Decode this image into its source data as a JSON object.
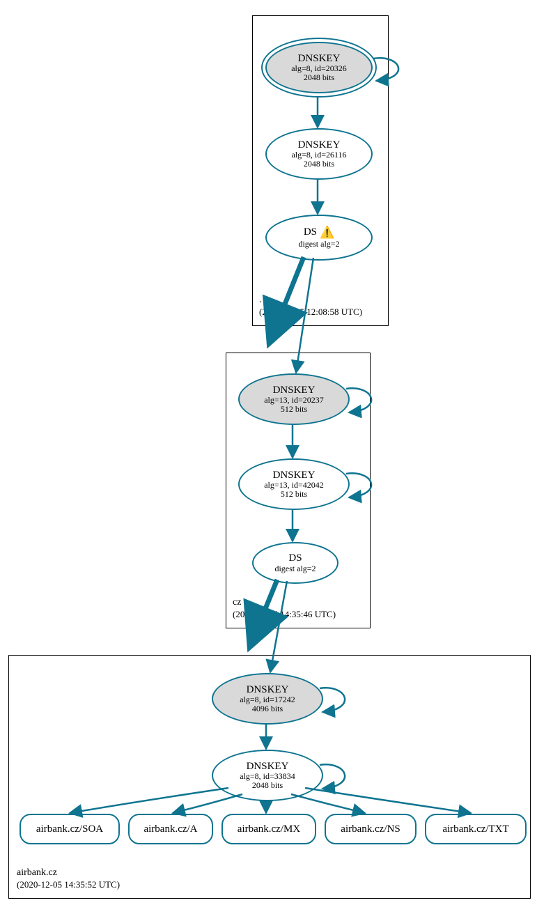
{
  "colors": {
    "stroke": "#0e7490",
    "ksk_fill": "#d9d9d9"
  },
  "zones": {
    "root": {
      "label": ".",
      "timestamp": "(2020-12-05 12:08:58 UTC)",
      "nodes": {
        "ksk": {
          "title": "DNSKEY",
          "line2": "alg=8, id=20326",
          "line3": "2048 bits"
        },
        "zsk": {
          "title": "DNSKEY",
          "line2": "alg=8, id=26116",
          "line3": "2048 bits"
        },
        "ds": {
          "title": "DS",
          "warn": "⚠️",
          "line2": "digest alg=2"
        }
      }
    },
    "cz": {
      "label": "cz",
      "timestamp": "(2020-12-05 14:35:46 UTC)",
      "nodes": {
        "ksk": {
          "title": "DNSKEY",
          "line2": "alg=13, id=20237",
          "line3": "512 bits"
        },
        "zsk": {
          "title": "DNSKEY",
          "line2": "alg=13, id=42042",
          "line3": "512 bits"
        },
        "ds": {
          "title": "DS",
          "line2": "digest alg=2"
        }
      }
    },
    "airbank": {
      "label": "airbank.cz",
      "timestamp": "(2020-12-05 14:35:52 UTC)",
      "nodes": {
        "ksk": {
          "title": "DNSKEY",
          "line2": "alg=8, id=17242",
          "line3": "4096 bits"
        },
        "zsk": {
          "title": "DNSKEY",
          "line2": "alg=8, id=33834",
          "line3": "2048 bits"
        }
      },
      "records": {
        "soa": "airbank.cz/SOA",
        "a": "airbank.cz/A",
        "mx": "airbank.cz/MX",
        "ns": "airbank.cz/NS",
        "txt": "airbank.cz/TXT"
      }
    }
  }
}
